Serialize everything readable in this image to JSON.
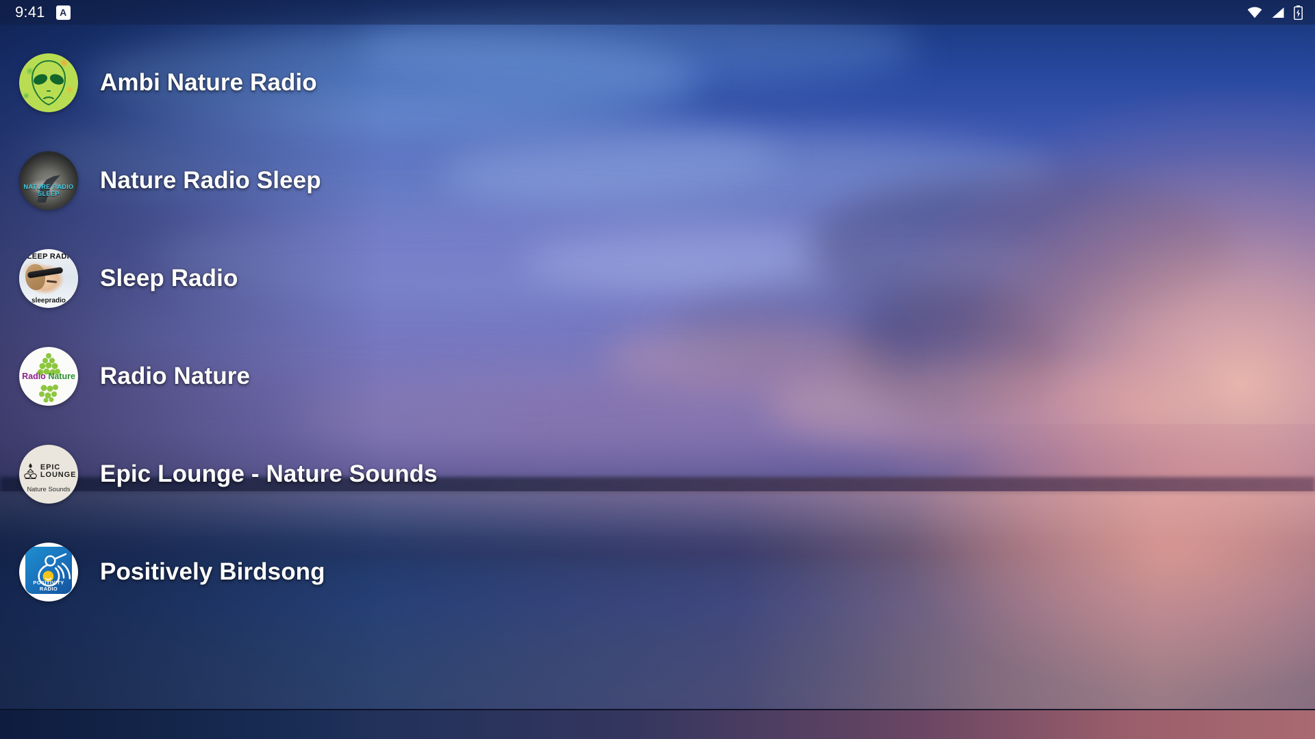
{
  "status_bar": {
    "time": "9:41",
    "notification_badge": "A",
    "icons": [
      "wifi-icon",
      "cellular-signal-icon",
      "battery-charging-icon"
    ]
  },
  "colors": {
    "text": "#ffffff",
    "status_bar_bg": "rgba(16,28,64,0.42)",
    "sky_top": "#16306e",
    "sky_mid": "#7670ba",
    "sunset_glow": "#ffc4aa",
    "water": "#2b4377"
  },
  "screen": {
    "background": "sunset-sky-over-lake-wallpaper"
  },
  "station_list": {
    "items": [
      {
        "name": "Ambi Nature Radio",
        "avatar": "alien-face-logo",
        "avatar_text": ""
      },
      {
        "name": "Nature Radio Sleep",
        "avatar": "kingfisher-photo-logo",
        "avatar_text": "NATURE RADIO SLEEP"
      },
      {
        "name": "Sleep Radio",
        "avatar": "sleeping-woman-photo-logo",
        "avatar_text_top": "SLEEP RADIO",
        "avatar_text_bottom": "sleepradio"
      },
      {
        "name": "Radio Nature",
        "avatar": "green-tree-logo",
        "avatar_text_first": "Radio",
        "avatar_text_second": "Nature"
      },
      {
        "name": "Epic Lounge - Nature Sounds",
        "avatar": "meditation-lotus-logo",
        "avatar_text_line1": "EPIC",
        "avatar_text_line2": "LOUNGE",
        "avatar_subtitle": "Nature Sounds"
      },
      {
        "name": "Positively Birdsong",
        "avatar": "bird-sun-logo",
        "avatar_text": "POSITIVITY RADIO"
      }
    ]
  }
}
